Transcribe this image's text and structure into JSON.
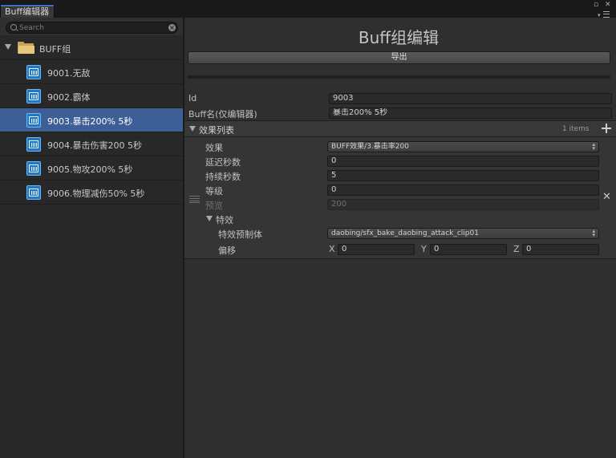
{
  "window": {
    "tab_title": "Buff编辑器",
    "maximize_glyph": "▫",
    "close_glyph": "✕"
  },
  "sidebar": {
    "search_placeholder": "Search",
    "root_label": "BUFF组",
    "items": [
      {
        "label": "9001.无敌",
        "selected": false
      },
      {
        "label": "9002.霸体",
        "selected": false
      },
      {
        "label": "9003.暴击200% 5秒",
        "selected": true
      },
      {
        "label": "9004.暴击伤害200 5秒",
        "selected": false
      },
      {
        "label": "9005.物攻200% 5秒",
        "selected": false
      },
      {
        "label": "9006.物理减伤50% 5秒",
        "selected": false
      }
    ]
  },
  "main": {
    "title": "Buff组编辑",
    "export_label": "导出",
    "id_label": "Id",
    "id_value": "9003",
    "name_label": "Buff名(仅编辑器)",
    "name_value": "暴击200% 5秒",
    "effects": {
      "header_label": "效果列表",
      "count_text": "1 items",
      "effect_label": "效果",
      "effect_value": "BUFF效果/3.暴击率200",
      "delay_label": "延迟秒数",
      "delay_value": "0",
      "duration_label": "持续秒数",
      "duration_value": "5",
      "level_label": "等级",
      "level_value": "0",
      "preview_label": "预览",
      "preview_value": "200",
      "fx_label": "特效",
      "prefab_label": "特效预制体",
      "prefab_value": "daobing/sfx_bake_daobing_attack_clip01",
      "offset_label": "偏移",
      "offset_x_label": "X",
      "offset_x_value": "0",
      "offset_y_label": "Y",
      "offset_y_value": "0",
      "offset_z_label": "Z",
      "offset_z_value": "0"
    }
  },
  "icons": {
    "folder": "folder-icon",
    "item": "buff-icon",
    "add": "plus-icon",
    "remove": "close-icon",
    "drag": "drag-handle-icon"
  },
  "colors": {
    "accent": "#3d6fb6",
    "selection": "#3e5f96",
    "panel": "#2f2f2f",
    "sidebar": "#282828"
  }
}
